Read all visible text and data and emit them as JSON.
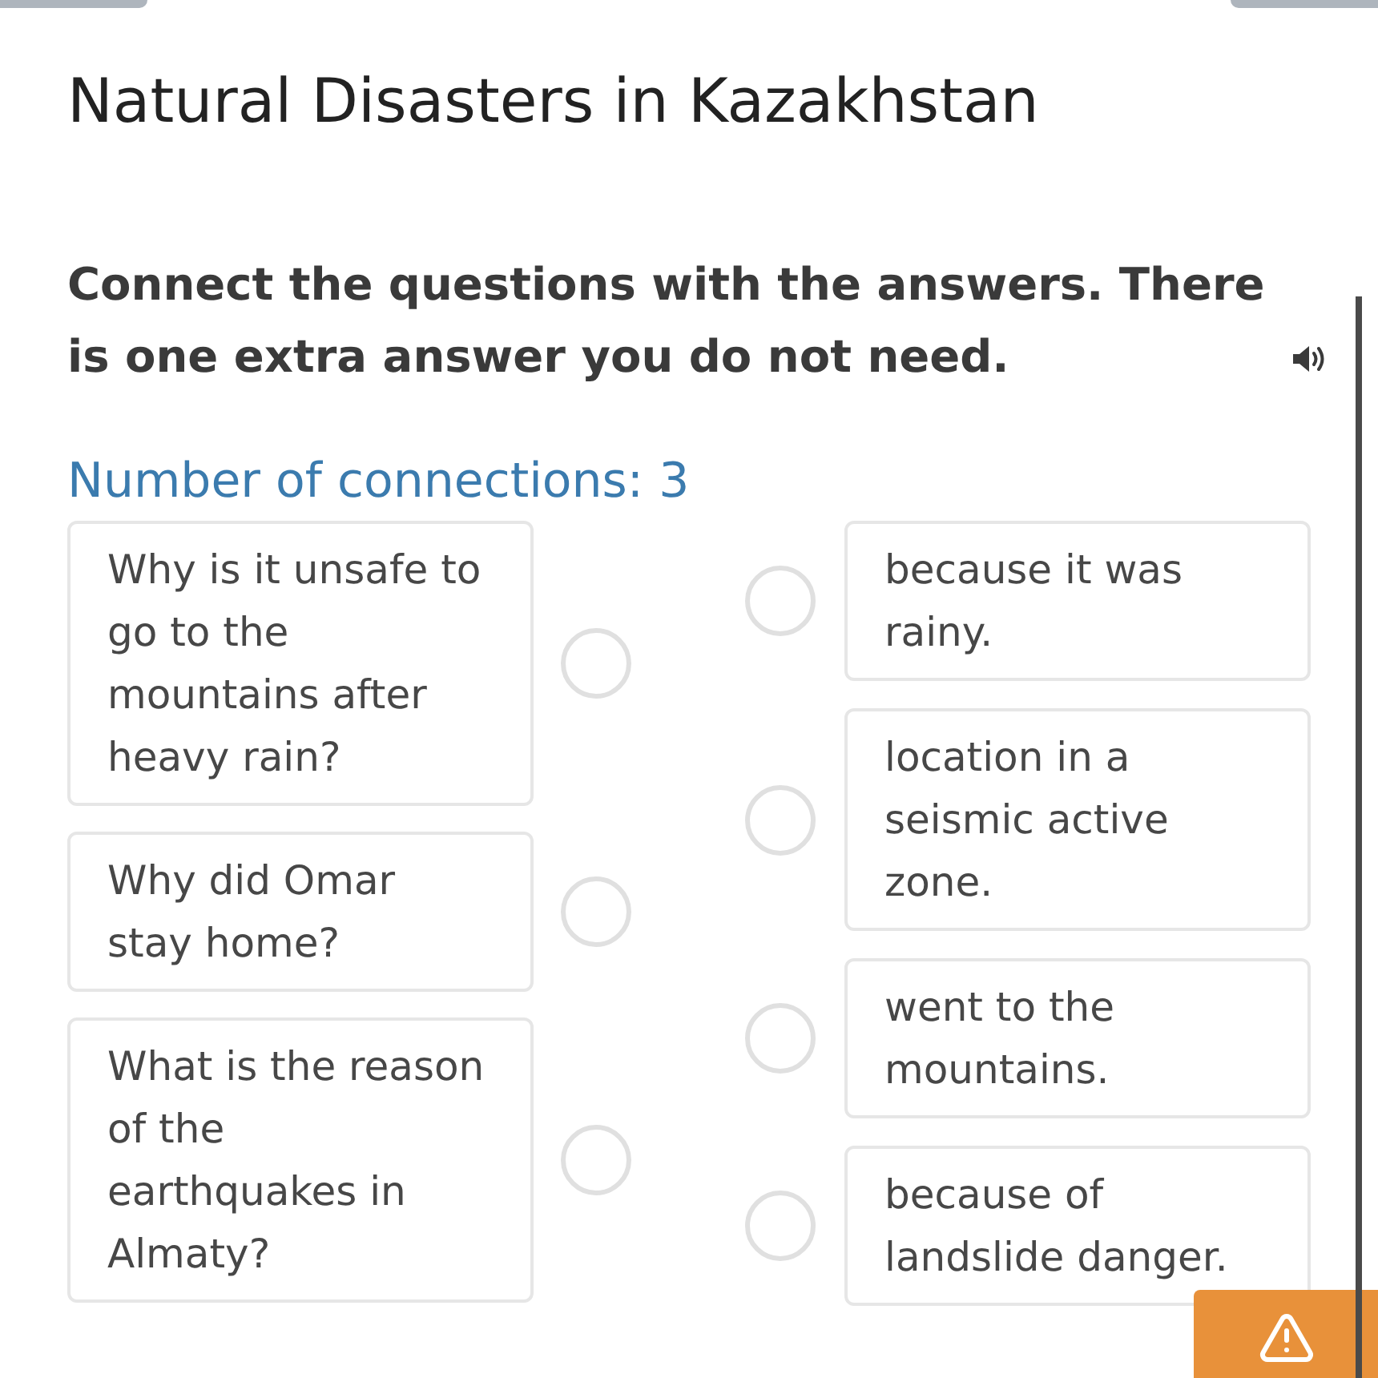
{
  "title": "Natural Disasters in Kazakhstan",
  "instruction": "Connect the questions with the answers. There is one extra answer you do not need.",
  "connections_label": "Number of connections: 3",
  "questions": [
    "Why is it unsafe to go to the mountains after heavy rain?",
    "Why did Omar stay home?",
    "What is the reason of the earthquakes in Almaty?"
  ],
  "answers": [
    "because it was rainy.",
    "location in a seismic active zone.",
    "went to the mountains.",
    "because of landslide danger."
  ]
}
